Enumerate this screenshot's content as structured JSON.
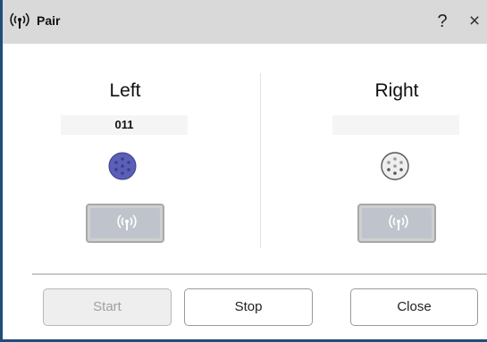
{
  "window": {
    "title": "Pair",
    "help_label": "?",
    "close_label": "×"
  },
  "left": {
    "title": "Left",
    "id_value": "011",
    "status": "active"
  },
  "right": {
    "title": "Right",
    "id_value": "",
    "status": "inactive"
  },
  "buttons": {
    "start": "Start",
    "stop": "Stop",
    "close": "Close"
  },
  "colors": {
    "accent_border": "#1f4e79",
    "active_dot": "#5a5fb8",
    "inactive_dot": "#eeeeee"
  }
}
